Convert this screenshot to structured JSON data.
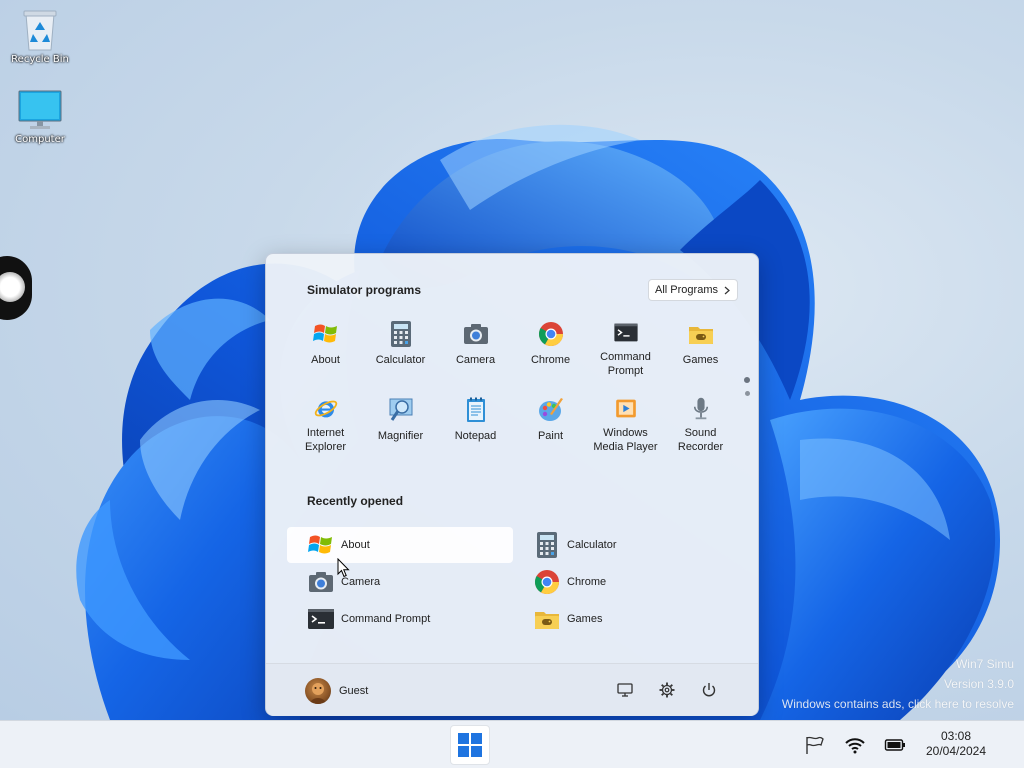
{
  "desktop": {
    "icons": [
      {
        "label": "Recycle Bin",
        "icon": "recycle-bin-icon"
      },
      {
        "label": "Computer",
        "icon": "computer-icon"
      }
    ]
  },
  "start_menu": {
    "programs_title": "Simulator programs",
    "all_programs_label": "All Programs",
    "programs": [
      {
        "label": "About",
        "icon": "windows-logo-icon"
      },
      {
        "label": "Calculator",
        "icon": "calculator-icon"
      },
      {
        "label": "Camera",
        "icon": "camera-icon"
      },
      {
        "label": "Chrome",
        "icon": "chrome-icon"
      },
      {
        "label": "Command\nPrompt",
        "icon": "command-prompt-icon"
      },
      {
        "label": "Games",
        "icon": "games-folder-icon"
      },
      {
        "label": "Internet\nExplorer",
        "icon": "internet-explorer-icon"
      },
      {
        "label": "Magnifier",
        "icon": "magnifier-icon"
      },
      {
        "label": "Notepad",
        "icon": "notepad-icon"
      },
      {
        "label": "Paint",
        "icon": "paint-icon"
      },
      {
        "label": "Windows\nMedia Player",
        "icon": "media-player-icon"
      },
      {
        "label": "Sound\nRecorder",
        "icon": "microphone-icon"
      }
    ],
    "recent_title": "Recently opened",
    "recent": [
      {
        "label": "About",
        "icon": "windows-logo-icon"
      },
      {
        "label": "Calculator",
        "icon": "calculator-icon"
      },
      {
        "label": "Camera",
        "icon": "camera-icon"
      },
      {
        "label": "Chrome",
        "icon": "chrome-icon"
      },
      {
        "label": "Command Prompt",
        "icon": "command-prompt-icon"
      },
      {
        "label": "Games",
        "icon": "games-folder-icon"
      }
    ],
    "user_name": "Guest"
  },
  "watermark": {
    "line1": "Win7 Simu",
    "line2": "Version 3.9.0",
    "line3": "Windows contains ads, click here to resolve"
  },
  "taskbar": {
    "time": "03:08",
    "date": "20/04/2024"
  },
  "colors": {
    "accent": "#1e74e0",
    "menu_bg": "#eef2f8",
    "taskbar_bg": "#edf1f7"
  }
}
